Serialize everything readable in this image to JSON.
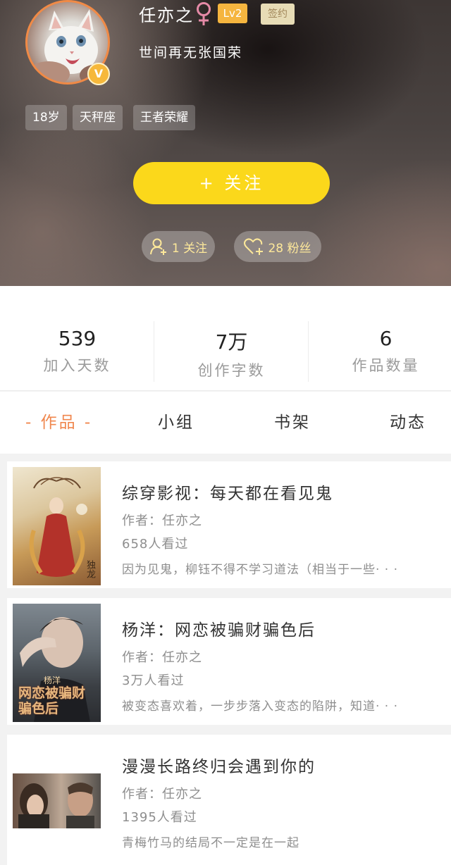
{
  "profile": {
    "username": "任亦之",
    "level": "Lv2",
    "signed": "签约",
    "bio": "世间再无张国荣",
    "verified_mark": "V",
    "tags": [
      "18岁",
      "天秤座",
      "王者荣耀"
    ],
    "follow_button": "+  关注",
    "following_label": "1 关注",
    "fans_label": "28 粉丝",
    "colors": {
      "accent": "#f0874e",
      "follow": "#fbd81b",
      "level": "#f5b53f",
      "gender": "#e58aa7"
    }
  },
  "stats": [
    {
      "value": "539",
      "label": "加入天数"
    },
    {
      "value": "7万",
      "label": "创作字数"
    },
    {
      "value": "6",
      "label": "作品数量"
    }
  ],
  "tabs": [
    {
      "label": "- 作品 -",
      "active": true
    },
    {
      "label": "小组",
      "active": false
    },
    {
      "label": "书架",
      "active": false
    },
    {
      "label": "动态",
      "active": false
    }
  ],
  "books": [
    {
      "title": "综穿影视：每天都在看见鬼",
      "author": "作者：任亦之",
      "views": "658人看过",
      "summary": "因为见鬼，柳钰不得不学习道法（相当于一些· · ·",
      "cover_text": "独龙"
    },
    {
      "title": "杨洋：网恋被骗财骗色后",
      "author": "作者：任亦之",
      "views": "3万人看过",
      "summary": "被变态喜欢着，一步步落入变态的陷阱，知道· · ·",
      "cover_text": "网恋被骗财骗色后",
      "cover_subtext": "杨洋"
    },
    {
      "title": "漫漫长路终归会遇到你的",
      "author": "作者：任亦之",
      "views": "1395人看过",
      "summary": "青梅竹马的结局不一定是在一起"
    }
  ]
}
